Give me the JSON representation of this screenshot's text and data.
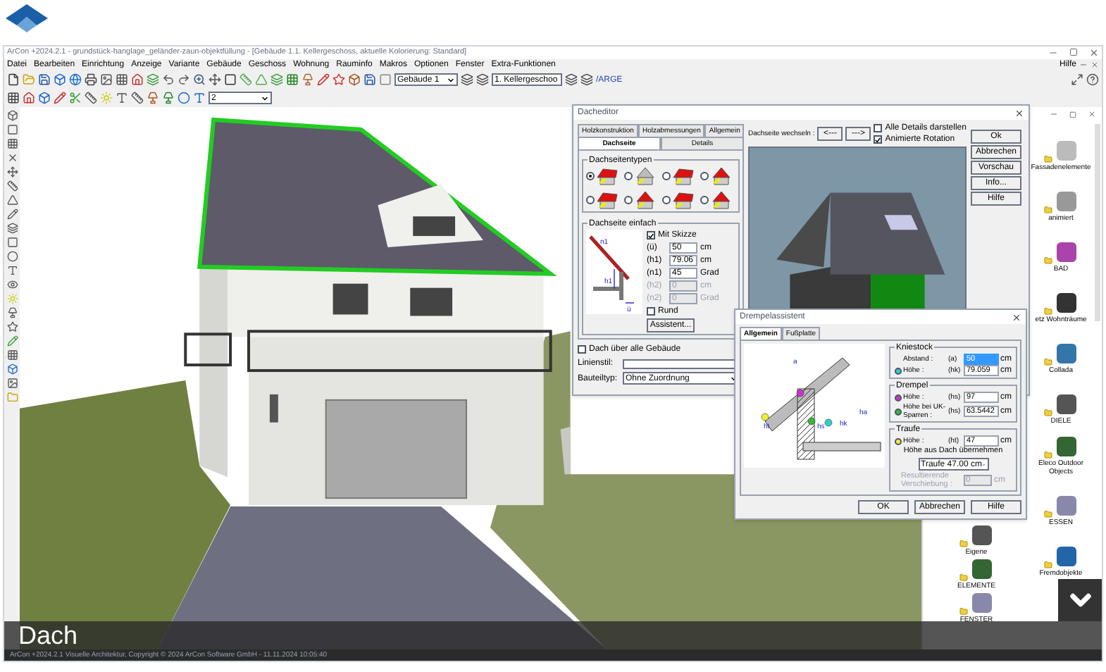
{
  "window": {
    "title": "ArCon +2024.2.1 - grundstück-hanglage_geländer-zaun-objektfüllung - [Gebäude 1.1. Kellergeschoss, aktuelle Kolorierung: Standard]"
  },
  "menu": {
    "items": [
      "Datei",
      "Bearbeiten",
      "Einrichtung",
      "Anzeige",
      "Variante",
      "Gebäude",
      "Geschoss",
      "Wohnung",
      "Rauminfo",
      "Makros",
      "Optionen",
      "Fenster",
      "Extra-Funktionen"
    ],
    "help": "Hilfe"
  },
  "toolbar": {
    "building": "Gebäude 1",
    "floor": "1. Kellergeschoo",
    "layer": "/ARGE",
    "zoom": "2"
  },
  "roof_editor": {
    "title": "Dacheditor",
    "tabs_row1": [
      {
        "label": "Holzkonstruktion",
        "selected": false
      },
      {
        "label": "Holzabmessungen",
        "selected": false
      },
      {
        "label": "Allgemein",
        "selected": false
      }
    ],
    "tabs_row2": [
      {
        "label": "Dachseite",
        "selected": true
      },
      {
        "label": "Details",
        "selected": false
      }
    ],
    "roof_types": {
      "title": "Dachseitentypen",
      "options": [
        {
          "selected": true
        },
        {
          "selected": false
        },
        {
          "selected": false
        },
        {
          "selected": false
        },
        {
          "selected": false
        },
        {
          "selected": false
        },
        {
          "selected": false
        },
        {
          "selected": false
        }
      ]
    },
    "simple_side": {
      "title": "Dachseite einfach",
      "sketch_labels": [
        "n1",
        "h1",
        "ü"
      ],
      "show_sketch": {
        "label": "Mit Skizze",
        "checked": true
      },
      "fields": [
        {
          "symbol": "(ü)",
          "value": "50",
          "unit": "cm",
          "disabled": false
        },
        {
          "symbol": "(h1)",
          "value": "79.06",
          "unit": "cm",
          "disabled": false
        },
        {
          "symbol": "(n1)",
          "value": "45",
          "unit": "Grad",
          "disabled": false
        },
        {
          "symbol": "(h2)",
          "value": "0",
          "unit": "cm",
          "disabled": true
        },
        {
          "symbol": "(n2)",
          "value": "0",
          "unit": "Grad",
          "disabled": true
        }
      ],
      "round": {
        "label": "Rund",
        "checked": false
      },
      "assistant_button": "Assistent..."
    },
    "all_buildings": {
      "label": "Dach über alle Gebäude",
      "checked": false
    },
    "line_style": {
      "label": "Linienstil:"
    },
    "component_type": {
      "label": "Bauteiltyp:",
      "value": "Ohne Zuordnung"
    },
    "switch_side": {
      "label": "Dachseite wechseln :",
      "prev": "<---",
      "next": "--->"
    },
    "show_all_details": {
      "label": "Alle Details darstellen",
      "checked": false
    },
    "animated_rotation": {
      "label": "Animierte Rotation",
      "checked": true
    },
    "buttons": [
      "Ok",
      "Abbrechen",
      "Vorschau",
      "Info...",
      "Hilfe"
    ]
  },
  "drempel_assistant": {
    "title": "Drempelassistent",
    "tabs": [
      {
        "label": "Allgemein",
        "selected": true
      },
      {
        "label": "Fußplatte",
        "selected": false
      }
    ],
    "diagram_labels": [
      "a",
      "ht",
      "hs",
      "hk",
      "ha"
    ],
    "groups": [
      {
        "title": "Kniestock",
        "rows": [
          {
            "label": "Abstand :",
            "symbol": "(a)",
            "value": "50",
            "unit": "cm",
            "highlighted": true
          },
          {
            "label": "Höhe :",
            "symbol": "(hk)",
            "value": "79.059",
            "unit": "cm",
            "highlighted": false,
            "color": "#33cccc"
          }
        ]
      },
      {
        "title": "Drempel",
        "rows": [
          {
            "label": "Höhe :",
            "symbol": "(hs)",
            "value": "97",
            "unit": "cm",
            "highlighted": false,
            "color": "#cc33cc"
          },
          {
            "label": "Höhe bei UK-Sparren :",
            "symbol": "(hs)",
            "value": "63.5442",
            "unit": "cm",
            "highlighted": false,
            "color": "#33bb33"
          }
        ]
      },
      {
        "title": "Traufe",
        "rows": [
          {
            "label": "Höhe :",
            "symbol": "(ht)",
            "value": "47",
            "unit": "cm",
            "highlighted": false,
            "color": "#eeee33"
          }
        ]
      }
    ],
    "take_from_roof": "Höhe aus Dach übernehmen",
    "eaves_select": "Traufe  47.00 cm",
    "shift": {
      "label": "Resultierende Verschiebung :",
      "value": "0",
      "unit": "cm",
      "disabled": true
    },
    "buttons": [
      "OK",
      "Abbrechen",
      "Hilfe"
    ]
  },
  "catalog": {
    "left_column": [
      "Eigene",
      "ELEMENTE",
      "FENSTER"
    ],
    "right_column": [
      "Fassadenelemente",
      "animiert",
      "BAD",
      "etz Wohnträume",
      "Collada",
      "DIELE",
      "Eleco Outdoor Objects",
      "ESSEN",
      "Fremdobjekte"
    ]
  },
  "caption": "Dach",
  "status_bar": "ArCon +2024.2.1 Visuelle Architektur, Copyright © 2024 ArCon Software GmbH - 11.11.2024 10:05:40"
}
